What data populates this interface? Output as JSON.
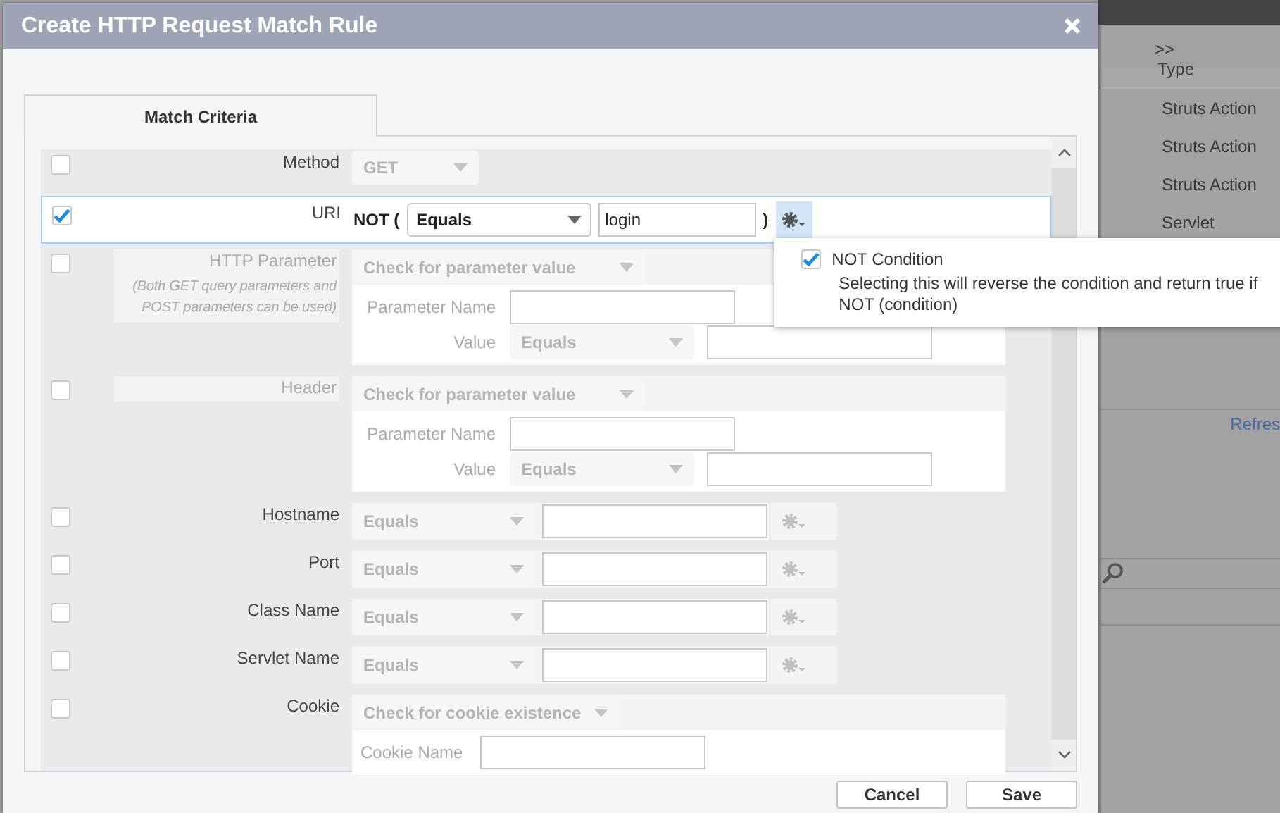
{
  "background_page": {
    "toggle": ">>",
    "column_header": "Type",
    "rows": [
      "Struts Action",
      "Struts Action",
      "Struts Action",
      "Servlet"
    ],
    "link": "Refres"
  },
  "dialog": {
    "title": "Create HTTP Request Match Rule",
    "tabs": [
      {
        "label": "Match Criteria",
        "selected": true
      }
    ],
    "criteria": [
      {
        "kind": "method",
        "label": "Method",
        "checked": false,
        "select": "GET"
      },
      {
        "kind": "condition",
        "label": "URI",
        "checked": true,
        "not": true,
        "not_prefix": "NOT (",
        "operator": "Equals",
        "value": "login",
        "close_paren": ")",
        "menu": {
          "open": true,
          "label": "NOT Condition",
          "checked": true,
          "description": "Selecting this will reverse the condition and return true if NOT (condition)"
        }
      },
      {
        "kind": "parameter",
        "label": "HTTP Parameter",
        "note": "(Both GET query parameters and POST parameters can be used)",
        "checked": false,
        "mode": "Check for parameter value",
        "fields": [
          {
            "kind": "text",
            "label": "Parameter Name"
          },
          {
            "kind": "match",
            "label": "Value",
            "operator": "Equals"
          }
        ]
      },
      {
        "kind": "parameter",
        "label": "Header",
        "checked": false,
        "mode": "Check for parameter value",
        "fields": [
          {
            "kind": "text",
            "label": "Parameter Name"
          },
          {
            "kind": "match",
            "label": "Value",
            "operator": "Equals"
          }
        ]
      },
      {
        "kind": "condition",
        "label": "Hostname",
        "checked": false,
        "operator": "Equals"
      },
      {
        "kind": "condition",
        "label": "Port",
        "checked": false,
        "operator": "Equals"
      },
      {
        "kind": "condition",
        "label": "Class Name",
        "checked": false,
        "operator": "Equals"
      },
      {
        "kind": "condition",
        "label": "Servlet Name",
        "checked": false,
        "operator": "Equals"
      },
      {
        "kind": "cookie",
        "label": "Cookie",
        "checked": false,
        "mode": "Check for cookie existence",
        "fields": [
          {
            "kind": "text",
            "label": "Cookie Name"
          }
        ]
      }
    ],
    "buttons": [
      "Cancel",
      "Save"
    ]
  }
}
